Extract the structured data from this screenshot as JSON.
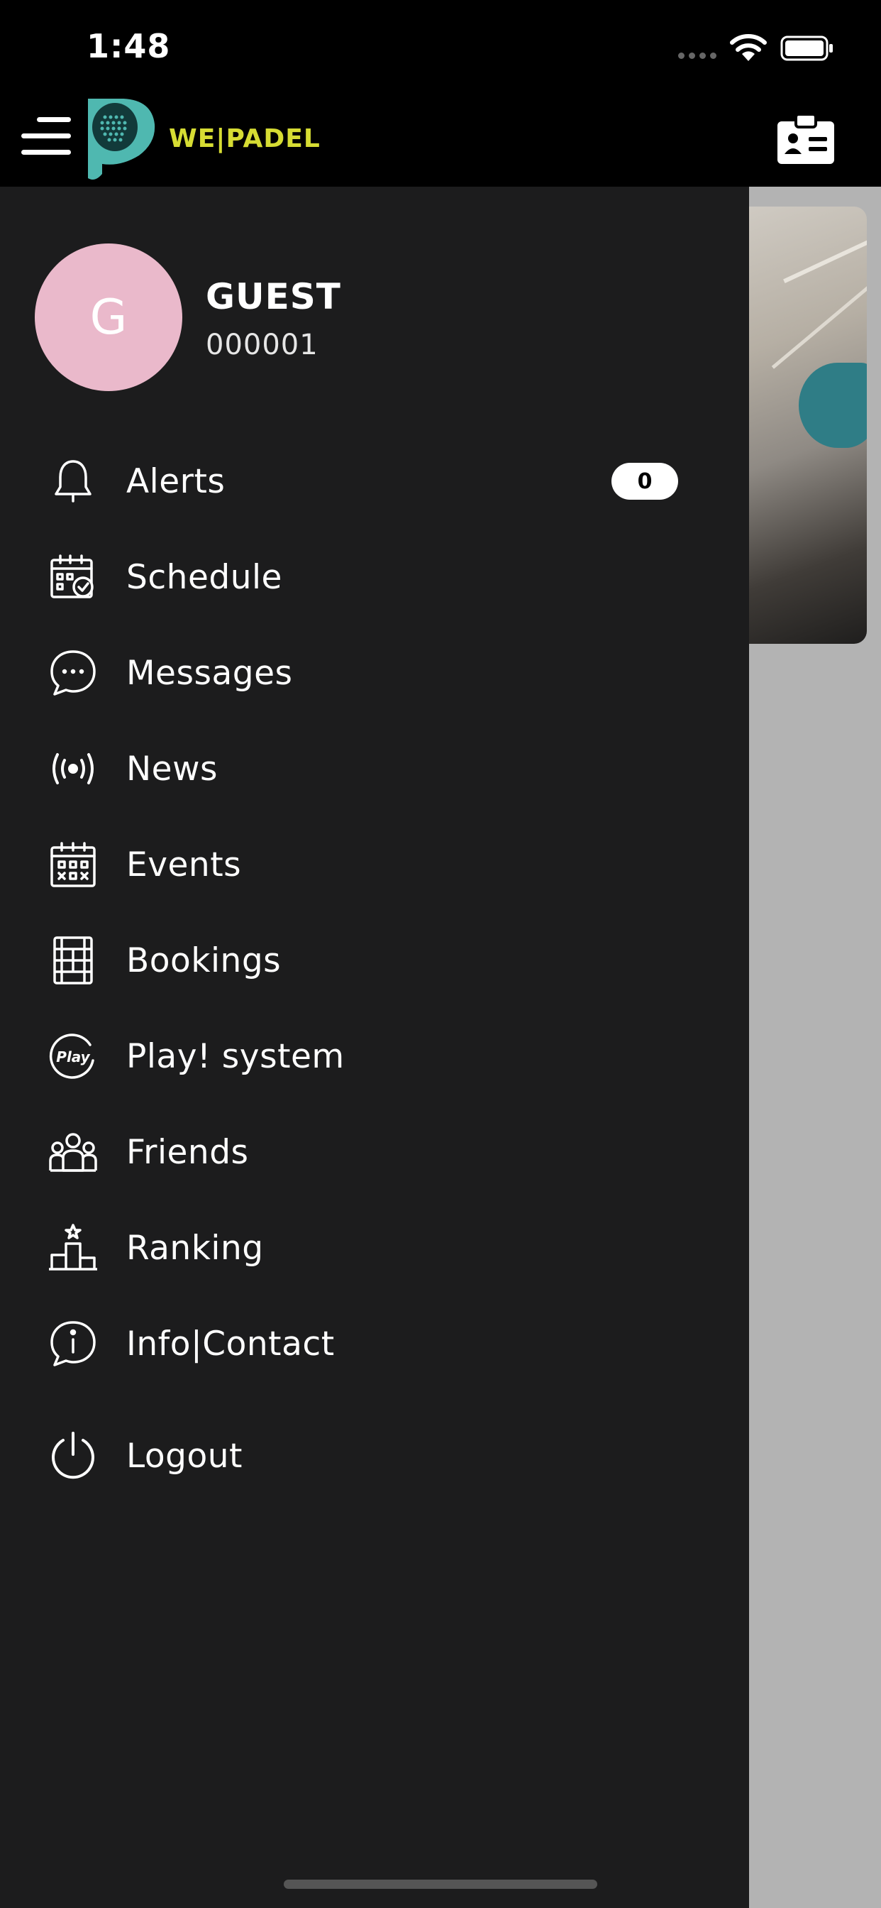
{
  "status_bar": {
    "time": "1:48"
  },
  "header": {
    "logo_text": "WE|PADEL"
  },
  "user": {
    "initial": "G",
    "name": "GUEST",
    "id": "000001"
  },
  "colors": {
    "drawer_bg": "#1c1c1d",
    "avatar_bg": "#eab9cb",
    "logo_accent": "#d6dc33",
    "logo_teal": "#4fb8b0"
  },
  "menu": {
    "alerts": {
      "label": "Alerts",
      "badge": "0",
      "icon": "bell-icon"
    },
    "schedule": {
      "label": "Schedule",
      "icon": "calendar-check-icon"
    },
    "messages": {
      "label": "Messages",
      "icon": "chat-bubble-icon"
    },
    "news": {
      "label": "News",
      "icon": "broadcast-icon"
    },
    "events": {
      "label": "Events",
      "icon": "calendar-grid-icon"
    },
    "bookings": {
      "label": "Bookings",
      "icon": "court-icon"
    },
    "play": {
      "label": "Play! system",
      "icon": "play-logo-icon"
    },
    "friends": {
      "label": "Friends",
      "icon": "people-icon"
    },
    "ranking": {
      "label": "Ranking",
      "icon": "podium-icon"
    },
    "info": {
      "label": "Info|Contact",
      "icon": "info-chat-icon"
    },
    "logout": {
      "label": "Logout",
      "icon": "power-icon"
    }
  }
}
